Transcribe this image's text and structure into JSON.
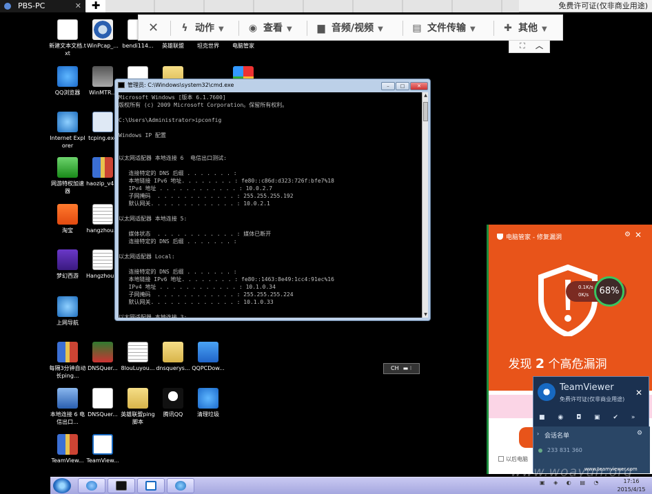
{
  "remote_tab": {
    "title": "PBS-PC",
    "close": "✕",
    "add": "✚"
  },
  "license_top": "免费许可证(仅非商业用途)",
  "toolbar": {
    "close": "✕",
    "actions": "动作",
    "view": "查看",
    "audio_video": "音频/视频",
    "file_transfer": "文件传输",
    "other": "其他",
    "caret": "▼",
    "sub_fullscreen": "⛶",
    "sub_collapse": "︿"
  },
  "desktop_icons": [
    {
      "label": "新建文本文档.txt",
      "icon": "text-document-icon"
    },
    {
      "label": "WinPcap_...",
      "icon": "winpcap-icon"
    },
    {
      "label": "bendi114...",
      "icon": "document-icon"
    },
    {
      "label": "英雄联盟",
      "icon": "game-icon"
    },
    {
      "label": "坦克世界",
      "icon": "game-icon"
    },
    {
      "label": "电脑管家",
      "icon": "pc-manager-icon"
    },
    {
      "label": "QQ浏览器",
      "icon": "qq-browser-icon"
    },
    {
      "label": "WinMTR...",
      "icon": "winmtr-icon"
    },
    {
      "label": "Internet Explorer",
      "icon": "ie-icon"
    },
    {
      "label": "tcping.exe",
      "icon": "tcping-icon"
    },
    {
      "label": "网游特权加速器",
      "icon": "accelerator-icon"
    },
    {
      "label": "haozip_v4...",
      "icon": "haozip-icon"
    },
    {
      "label": "淘宝",
      "icon": "taobao-icon"
    },
    {
      "label": "hangzhou...",
      "icon": "text-file-icon"
    },
    {
      "label": "梦幻西游",
      "icon": "game-icon"
    },
    {
      "label": "Hangzhou...",
      "icon": "text-file-icon"
    },
    {
      "label": "上网导航",
      "icon": "ie-nav-icon"
    },
    {
      "label": "每隔3分钟自动长ping...",
      "icon": "archive-icon"
    },
    {
      "label": "DNSQuer...",
      "icon": "board-icon"
    },
    {
      "label": "8louLuyou...",
      "icon": "text-file-icon"
    },
    {
      "label": "dnsquerys...",
      "icon": "folder-icon"
    },
    {
      "label": "QQPCDow...",
      "icon": "qq-pc-shield-icon"
    },
    {
      "label": "本地连接 6 电信出口...",
      "icon": "network-icon"
    },
    {
      "label": "DNSQuer...",
      "icon": "document-icon"
    },
    {
      "label": "英雄联盟ping脚本",
      "icon": "folder-icon"
    },
    {
      "label": "腾讯QQ",
      "icon": "qq-icon"
    },
    {
      "label": "清理垃圾",
      "icon": "cleanup-icon"
    },
    {
      "label": "TeamView...",
      "icon": "archive-icon"
    },
    {
      "label": "TeamView...",
      "icon": "teamviewer-icon"
    }
  ],
  "cmd": {
    "title": "管理员: C:\\Windows\\system32\\cmd.exe",
    "min": "–",
    "max": "□",
    "close": "✕",
    "text": "Microsoft Windows [版本 6.1.7600]\n版权所有 (c) 2009 Microsoft Corporation。保留所有权利。\n\nC:\\Users\\Administrator>ipconfig\n\nWindows IP 配置\n\n\n以太网适配器 本地连接 6  电信出口测试:\n\n   连接特定的 DNS 后缀 . . . . . . . :\n   本地链接 IPv6 地址. . . . . . . . : fe80::c86d:d323:726f:bfe7%18\n   IPv4 地址 . . . . . . . . . . . . : 10.0.2.7\n   子网掩码  . . . . . . . . . . . . : 255.255.255.192\n   默认网关. . . . . . . . . . . . . : 10.0.2.1\n\n以太网适配器 本地连接 5:\n\n   媒体状态  . . . . . . . . . . . . : 媒体已断开\n   连接特定的 DNS 后缀 . . . . . . . :\n\n以太网适配器 Local:\n\n   连接特定的 DNS 后缀 . . . . . . . :\n   本地链接 IPv6 地址. . . . . . . . : fe80::1463:8e49:1cc4:91ec%16\n   IPv4 地址 . . . . . . . . . . . . : 10.1.0.34\n   子网掩码  . . . . . . . . . . . . : 255.255.255.224\n   默认网关. . . . . . . . . . . . . : 10.1.0.33\n\n以太网适配器 本地连接 3:"
  },
  "langbar": "CH",
  "pc_manager": {
    "title": "电脑管家 - 修复漏洞",
    "gear": "⚙",
    "close": "✕",
    "up_speed": "0.1K/s",
    "down_speed": "0K/s",
    "score": "68%",
    "headline_pre": "发现 ",
    "headline_count": "2",
    "headline_post": " 个高危漏洞",
    "later": "以后电脑",
    "accent": "#e8541a"
  },
  "teamviewer_panel": {
    "name": "TeamViewer",
    "license": "免费许可证(仅非商业用途)",
    "close": "✕",
    "icons": "■ ◉ ◘ ▣ ✔ »",
    "list_header": "会话名单",
    "list_item": "233 831 360",
    "gear": "⚙",
    "domain": "www.teamviewer.com"
  },
  "taskbar": {
    "tray": "▣ ◈ ◐ ▤ ◔",
    "time": "17:16",
    "date": "2015/4/15"
  },
  "watermark": "www.woayun.org"
}
